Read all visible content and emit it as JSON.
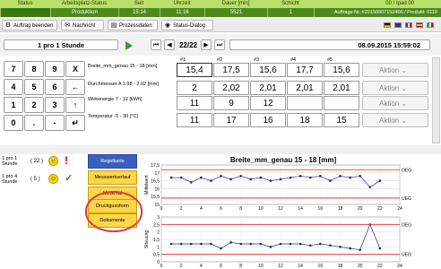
{
  "header": {
    "cols": [
      {
        "title": "Status",
        "value": ""
      },
      {
        "title": "Arbeitsplatz-Status",
        "value": "Produktion"
      },
      {
        "title": "Seit",
        "value": "15:14"
      },
      {
        "title": "Uhrzeit",
        "value": "11:16"
      },
      {
        "title": "Dauer [min]",
        "value": "5521"
      },
      {
        "title": "Schicht",
        "value": "1"
      },
      {
        "title": "00  / Ipad 00",
        "value": "Auftrags-Nr.:#20150907152406 / Produkt: 0110"
      }
    ]
  },
  "toolbar": {
    "buttons": [
      {
        "label": "Auftrag beenden",
        "icon": "gear-icon"
      },
      {
        "label": "Nachricht",
        "icon": "mail-icon"
      },
      {
        "label": "Prozessdaten",
        "icon": "table-icon"
      },
      {
        "label": "Status-Dialog",
        "icon": "status-icon"
      }
    ],
    "flags": [
      "de",
      "gb",
      "fr",
      "es",
      "it"
    ]
  },
  "nav": {
    "mode": "1 pro 1 Stunde",
    "page": "22/22",
    "datetime": "08.09.2015 15:59:02"
  },
  "keypad": [
    [
      "7",
      "8",
      "9",
      "X"
    ],
    [
      "4",
      "5",
      "6",
      "←"
    ],
    [
      "1",
      "2",
      "3",
      "↑"
    ],
    [
      "0",
      ".",
      "-",
      "↵"
    ]
  ],
  "columns": [
    "#1",
    "#2",
    "#3",
    "#4",
    "#5"
  ],
  "rows": [
    {
      "label": "Breite_mm_genau 15 - 18 [mm]",
      "values": [
        "15,4",
        "17,5",
        "15,6",
        "17,7",
        "15,6"
      ],
      "action": "Aktion"
    },
    {
      "label": "Durchmesser A 1.98 - 2.02 [mm]",
      "values": [
        "2",
        "2,02",
        "2,01",
        "2,01",
        "2,01"
      ],
      "action": "Aktion"
    },
    {
      "label": "Wirkenergie 7 - 12 [kWh]",
      "values": [
        "11",
        "9",
        "12",
        "",
        ""
      ],
      "action": "Aktion"
    },
    {
      "label": "Temperatur -5 - 30 [°C]",
      "values": [
        "11",
        "17",
        "16",
        "18",
        "15"
      ],
      "action": "Aktion"
    }
  ],
  "status_list": [
    {
      "label": "1 pro 1 Stunde",
      "count": "( 22 )",
      "mark": "!"
    },
    {
      "label": "1 pro 4 Stunde",
      "count": "( 5 )",
      "mark": "✓"
    }
  ],
  "side_buttons": [
    "Regelkarte",
    "Messwertverlauf",
    "Merkmal",
    "Druckgussform",
    "Dokumente"
  ],
  "chart_data": [
    {
      "type": "line",
      "title": "Breite_mm_genau 15 - 18 [mm]",
      "ylabel": "Mittelwert",
      "x": [
        1,
        2,
        3,
        4,
        5,
        6,
        7,
        8,
        9,
        10,
        11,
        12,
        13,
        14,
        15,
        16,
        17,
        18,
        19,
        20,
        21,
        22
      ],
      "values": [
        16.7,
        16.7,
        16.4,
        16.7,
        16.5,
        16.8,
        16.6,
        16.8,
        16.6,
        16.7,
        16.5,
        16.6,
        16.7,
        16.8,
        16.7,
        16.8,
        16.5,
        16.8,
        16.7,
        16.8,
        16.1,
        16.5
      ],
      "ylim": [
        15,
        17.5
      ],
      "yticks": [
        "17,5",
        "17",
        "16,5",
        "16",
        "15,5",
        "15"
      ],
      "xlim": [
        0,
        24
      ],
      "xticks": [
        "0",
        "2",
        "4",
        "6",
        "8",
        "10",
        "12",
        "14",
        "16",
        "18",
        "20",
        "22",
        "24"
      ],
      "limits": [
        {
          "label": "OEG",
          "value": 17.2
        },
        {
          "label": "UEG",
          "value": 15.4
        }
      ]
    },
    {
      "type": "line",
      "ylabel": "Streuung",
      "x": [
        1,
        2,
        3,
        4,
        5,
        6,
        7,
        8,
        9,
        10,
        11,
        12,
        13,
        14,
        15,
        16,
        17,
        18,
        19,
        20,
        21,
        22
      ],
      "values": [
        1.2,
        1.2,
        1.2,
        1.2,
        1.2,
        0.9,
        1.3,
        1.2,
        1.2,
        1.2,
        1.0,
        1.2,
        1.2,
        1.2,
        1.1,
        1.2,
        1.1,
        1.0,
        0.9,
        0.8,
        2.5,
        0.9
      ],
      "ylim": [
        0,
        3
      ],
      "yticks": [
        "3",
        "2,5",
        "2",
        "1,5",
        "1",
        "0,5",
        "0"
      ],
      "xlim": [
        0,
        24
      ],
      "xticks": [
        "0",
        "2",
        "4",
        "6",
        "8",
        "10",
        "12",
        "14",
        "16",
        "18",
        "20",
        "22",
        "24"
      ],
      "limits": [
        {
          "label": "OEG",
          "value": 2.5
        },
        {
          "label": "UEG",
          "value": 0.5
        }
      ]
    }
  ]
}
